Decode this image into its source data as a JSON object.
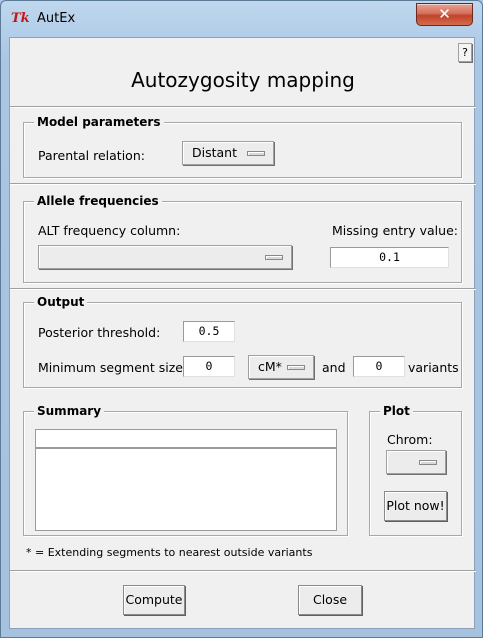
{
  "window": {
    "title": "AutEx",
    "close_glyph": "✕",
    "icon_glyph": "Tk",
    "help_label": "?"
  },
  "page_title": "Autozygosity mapping",
  "model_parameters": {
    "label": "Model parameters",
    "parental_relation_label": "Parental relation:",
    "parental_relation_value": "Distant"
  },
  "allele_frequencies": {
    "label": "Allele frequencies",
    "alt_column_label": "ALT frequency column:",
    "alt_column_value": "",
    "missing_entry_label": "Missing entry value:",
    "missing_entry_value": "0.1"
  },
  "output": {
    "label": "Output",
    "posterior_threshold_label": "Posterior threshold:",
    "posterior_threshold_value": "0.5",
    "min_segment_label": "Minimum segment size:",
    "min_segment_value": "0",
    "unit_value": "cM*",
    "and_label": "and",
    "variants_value": "0",
    "variants_label": "variants"
  },
  "summary": {
    "label": "Summary",
    "header_value": ""
  },
  "plot": {
    "label": "Plot",
    "chrom_label": "Chrom:",
    "chrom_value": "",
    "plot_button": "Plot now!"
  },
  "footnote": "* = Extending segments to nearest outside variants",
  "buttons": {
    "compute": "Compute",
    "close": "Close"
  }
}
